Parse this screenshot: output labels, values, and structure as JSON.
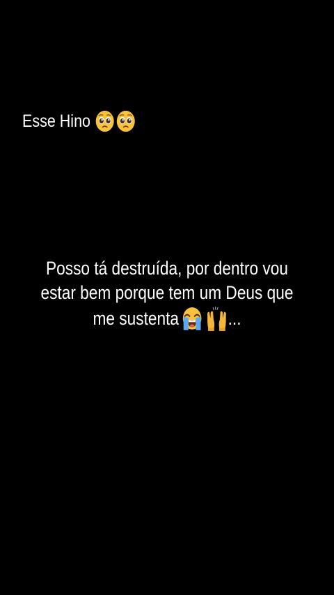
{
  "story": {
    "top_caption": "Esse Hino",
    "top_caption_icons": [
      "pleading-face-icon",
      "pleading-face-icon"
    ],
    "main_caption": {
      "line1": "Posso tá destruída, por dentro vou",
      "line2": "estar bem porque tem um Deus que",
      "line3": "me sustenta",
      "trailing": "..."
    },
    "main_caption_icons": [
      "loudly-crying-face-icon",
      "raising-hands-icon"
    ]
  },
  "colors": {
    "background": "#000000",
    "text": "#ffffff",
    "emoji_face": "#F9C23C",
    "emoji_tear": "#5BA8F5"
  }
}
